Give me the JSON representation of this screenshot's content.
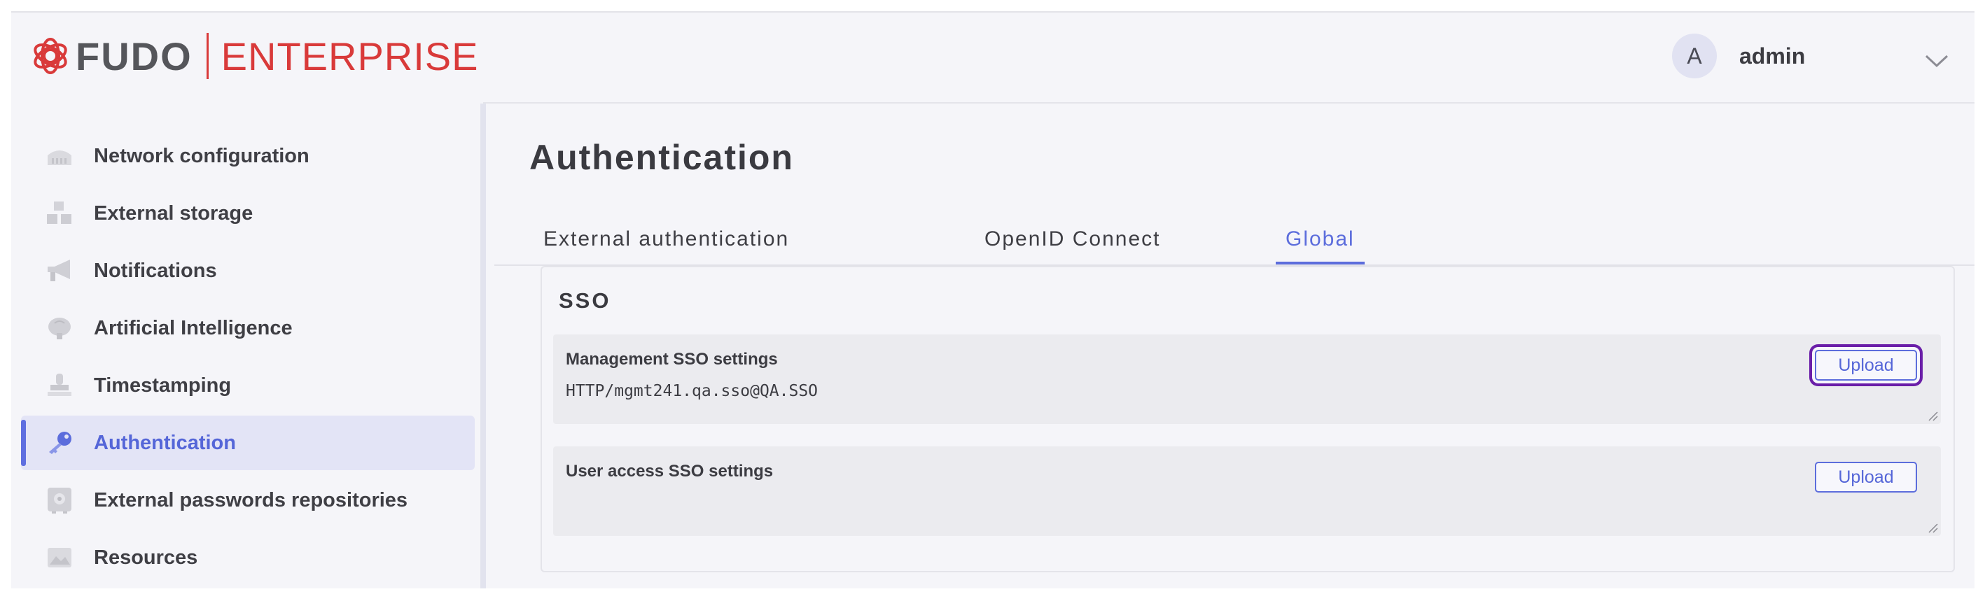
{
  "header": {
    "logo_fudo": "FUDO",
    "logo_enterprise": "ENTERPRISE",
    "avatar_initial": "A",
    "user_name": "admin"
  },
  "sidebar": {
    "items": [
      {
        "label": "Network configuration",
        "icon": "network-icon",
        "active": false
      },
      {
        "label": "External storage",
        "icon": "storage-icon",
        "active": false
      },
      {
        "label": "Notifications",
        "icon": "megaphone-icon",
        "active": false
      },
      {
        "label": "Artificial Intelligence",
        "icon": "brain-icon",
        "active": false
      },
      {
        "label": "Timestamping",
        "icon": "stamp-icon",
        "active": false
      },
      {
        "label": "Authentication",
        "icon": "key-icon",
        "active": true
      },
      {
        "label": "External passwords repositories",
        "icon": "vault-icon",
        "active": false
      },
      {
        "label": "Resources",
        "icon": "resources-icon",
        "active": false
      }
    ]
  },
  "main": {
    "title": "Authentication",
    "tabs": [
      {
        "label": "External authentication",
        "active": false
      },
      {
        "label": "OpenID Connect",
        "active": false
      },
      {
        "label": "Global",
        "active": true
      }
    ],
    "card": {
      "title": "SSO",
      "fields": [
        {
          "label": "Management SSO settings",
          "value": "HTTP/mgmt241.qa.sso@QA.SSO",
          "button": "Upload"
        },
        {
          "label": "User access SSO settings",
          "value": "",
          "button": "Upload"
        }
      ]
    }
  },
  "colors": {
    "accent": "#5c6ddc",
    "brand_red": "#d93a3a",
    "focus_ring": "#6a1ea8",
    "active_nav_bg": "#e3e4f6"
  }
}
